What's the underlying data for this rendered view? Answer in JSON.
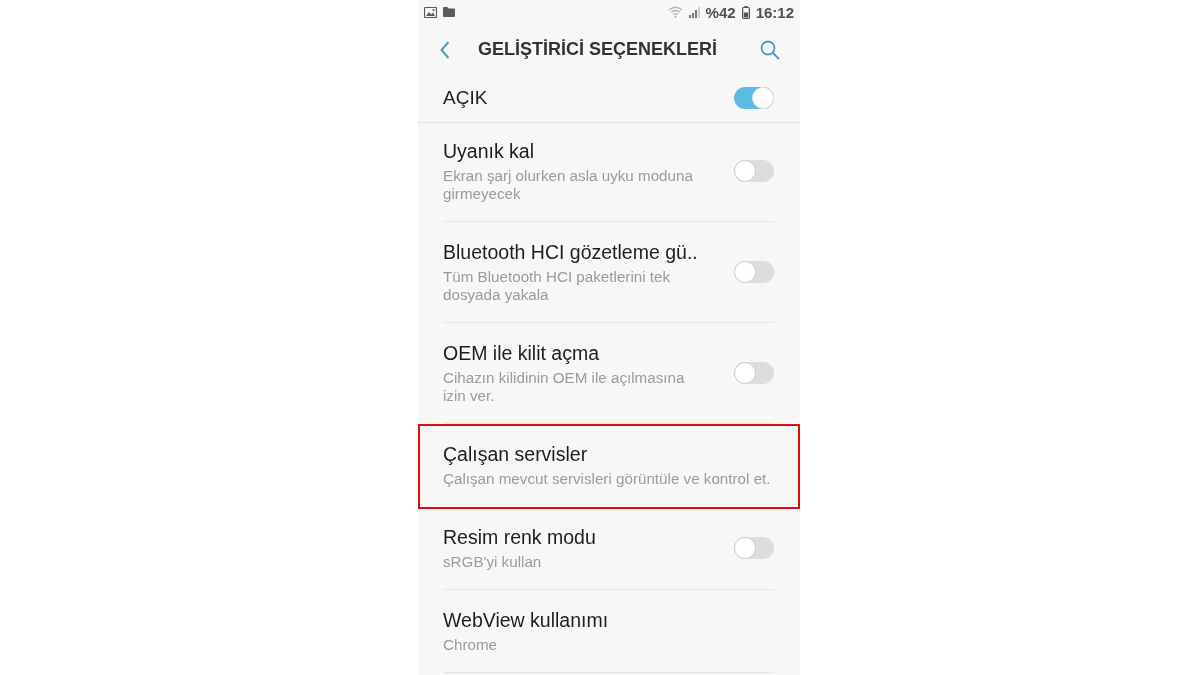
{
  "status_bar": {
    "battery": "%42",
    "time": "16:12"
  },
  "header": {
    "title": "GELİŞTİRİCİ SEÇENEKLERİ"
  },
  "master": {
    "label": "AÇIK",
    "on": true
  },
  "settings": [
    {
      "kind": "toggle",
      "title": "Uyanık kal",
      "subtitle": "Ekran şarj olurken asla uyku moduna girmeyecek",
      "on": false,
      "highlighted": false
    },
    {
      "kind": "toggle",
      "title": "Bluetooth HCI gözetleme gü..",
      "subtitle": "Tüm Bluetooth HCI paketlerini tek dosyada yakala",
      "on": false,
      "highlighted": false
    },
    {
      "kind": "toggle",
      "title": "OEM ile kilit açma",
      "subtitle": "Cihazın kilidinin OEM ile açılmasına izin ver.",
      "on": false,
      "highlighted": false
    },
    {
      "kind": "link",
      "title": "Çalışan servisler",
      "subtitle": "Çalışan mevcut servisleri görüntüle ve kontrol et.",
      "highlighted": true
    },
    {
      "kind": "toggle",
      "title": "Resim renk modu",
      "subtitle": "sRGB'yi kullan",
      "on": false,
      "highlighted": false
    },
    {
      "kind": "link",
      "title": "WebView kullanımı",
      "subtitle": "Chrome",
      "highlighted": false
    }
  ]
}
